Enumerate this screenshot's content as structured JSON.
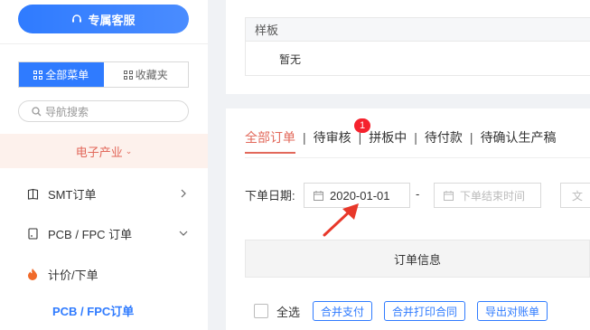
{
  "sidebar": {
    "service_label": "专属客服",
    "tabs": [
      {
        "label": "全部菜单",
        "active": true
      },
      {
        "label": "收藏夹",
        "active": false
      }
    ],
    "search_placeholder": "导航搜索",
    "industry": "电子产业",
    "items": [
      {
        "label": "SMT订单",
        "icon": "book-icon",
        "arrow": "chevron-right-icon"
      },
      {
        "label": "PCB / FPC 订单",
        "icon": "file-icon",
        "arrow": "chevron-down-icon"
      },
      {
        "label": "计价/下单",
        "icon": "fire-icon"
      },
      {
        "label": "PCB / FPC订单"
      }
    ]
  },
  "sample_table": {
    "header": "样板",
    "row_value": "暂无"
  },
  "order_tabs": {
    "items": [
      "全部订单",
      "待审核",
      "拼板中",
      "待付款",
      "待确认生产稿"
    ],
    "separator": "|",
    "active_index": 0,
    "badge_count": "1"
  },
  "filter": {
    "date_label": "下单日期:",
    "start_date": "2020-01-01",
    "dash": "-",
    "end_placeholder": "下单结束时间",
    "more_placeholder": "文"
  },
  "order_info_header": "订单信息",
  "actions": {
    "select_all": "全选",
    "buttons": [
      "合并支付",
      "合并打印合同",
      "导出对账单"
    ]
  },
  "colors": {
    "primary": "#2f7bff",
    "accent": "#e2685a",
    "badge": "#f5222d",
    "annotation_arrow": "#e8382a"
  }
}
